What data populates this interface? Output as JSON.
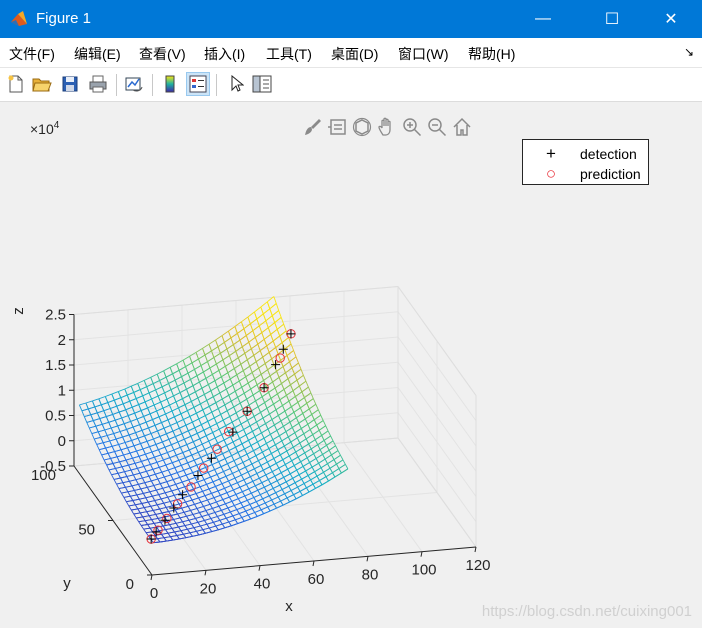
{
  "window": {
    "title": "Figure 1",
    "minimize": "—",
    "maximize": "☐",
    "close": "✕"
  },
  "menu": {
    "items": [
      "文件(F)",
      "编辑(E)",
      "查看(V)",
      "插入(I)",
      "工具(T)",
      "桌面(D)",
      "窗口(W)",
      "帮助(H)"
    ],
    "overflow_icon": "↘"
  },
  "toolbar": {
    "icons": [
      "new-figure-icon",
      "open-file-icon",
      "save-icon",
      "print-icon",
      "link-plot-icon",
      "colorbar-icon",
      "legend-icon",
      "pointer-icon",
      "property-inspector-icon"
    ]
  },
  "axes_toolbar": {
    "icons": [
      "brush-icon",
      "datatip-icon",
      "rotate-3d-icon",
      "pan-icon",
      "zoom-in-icon",
      "zoom-out-icon",
      "home-icon"
    ]
  },
  "chart_data": {
    "type": "surface+scatter3d",
    "title": "",
    "xlabel": "x",
    "ylabel": "y",
    "zlabel": "z",
    "z_exponent_label": "×10",
    "z_exponent": "4",
    "xticks": [
      "0",
      "20",
      "40",
      "60",
      "80",
      "100",
      "120"
    ],
    "yticks": [
      "0",
      "50",
      "100"
    ],
    "zticks": [
      "-0.5",
      "0",
      "0.5",
      "1",
      "1.5",
      "2",
      "2.5"
    ],
    "xlim": [
      0,
      120
    ],
    "ylim": [
      0,
      100
    ],
    "zlim": [
      -5000,
      25000
    ],
    "colormap": "parula",
    "grid": true,
    "legend_position": "top-right",
    "series": [
      {
        "name": "detection",
        "marker": "+",
        "color": "#000000",
        "points": [
          [
            2,
            8,
            300
          ],
          [
            5,
            12,
            700
          ],
          [
            10,
            18,
            1500
          ],
          [
            15,
            24,
            2400
          ],
          [
            20,
            30,
            3500
          ],
          [
            28,
            38,
            5200
          ],
          [
            35,
            45,
            6800
          ],
          [
            45,
            52,
            10000
          ],
          [
            52,
            58,
            12500
          ],
          [
            60,
            64,
            15500
          ],
          [
            66,
            70,
            18500
          ],
          [
            70,
            74,
            20500
          ],
          [
            74,
            78,
            22500
          ]
        ]
      },
      {
        "name": "prediction",
        "marker": "o",
        "color": "#e8313a",
        "points": [
          [
            2,
            8,
            300
          ],
          [
            6,
            13,
            800
          ],
          [
            11,
            19,
            1600
          ],
          [
            17,
            26,
            2700
          ],
          [
            24,
            33,
            4200
          ],
          [
            31,
            41,
            5900
          ],
          [
            38,
            48,
            7800
          ],
          [
            44,
            54,
            9700
          ],
          [
            52,
            58,
            12500
          ],
          [
            60,
            64,
            15500
          ],
          [
            68,
            71,
            19500
          ],
          [
            74,
            78,
            22500
          ]
        ]
      }
    ]
  },
  "watermark": "https://blog.csdn.net/cuixing001"
}
